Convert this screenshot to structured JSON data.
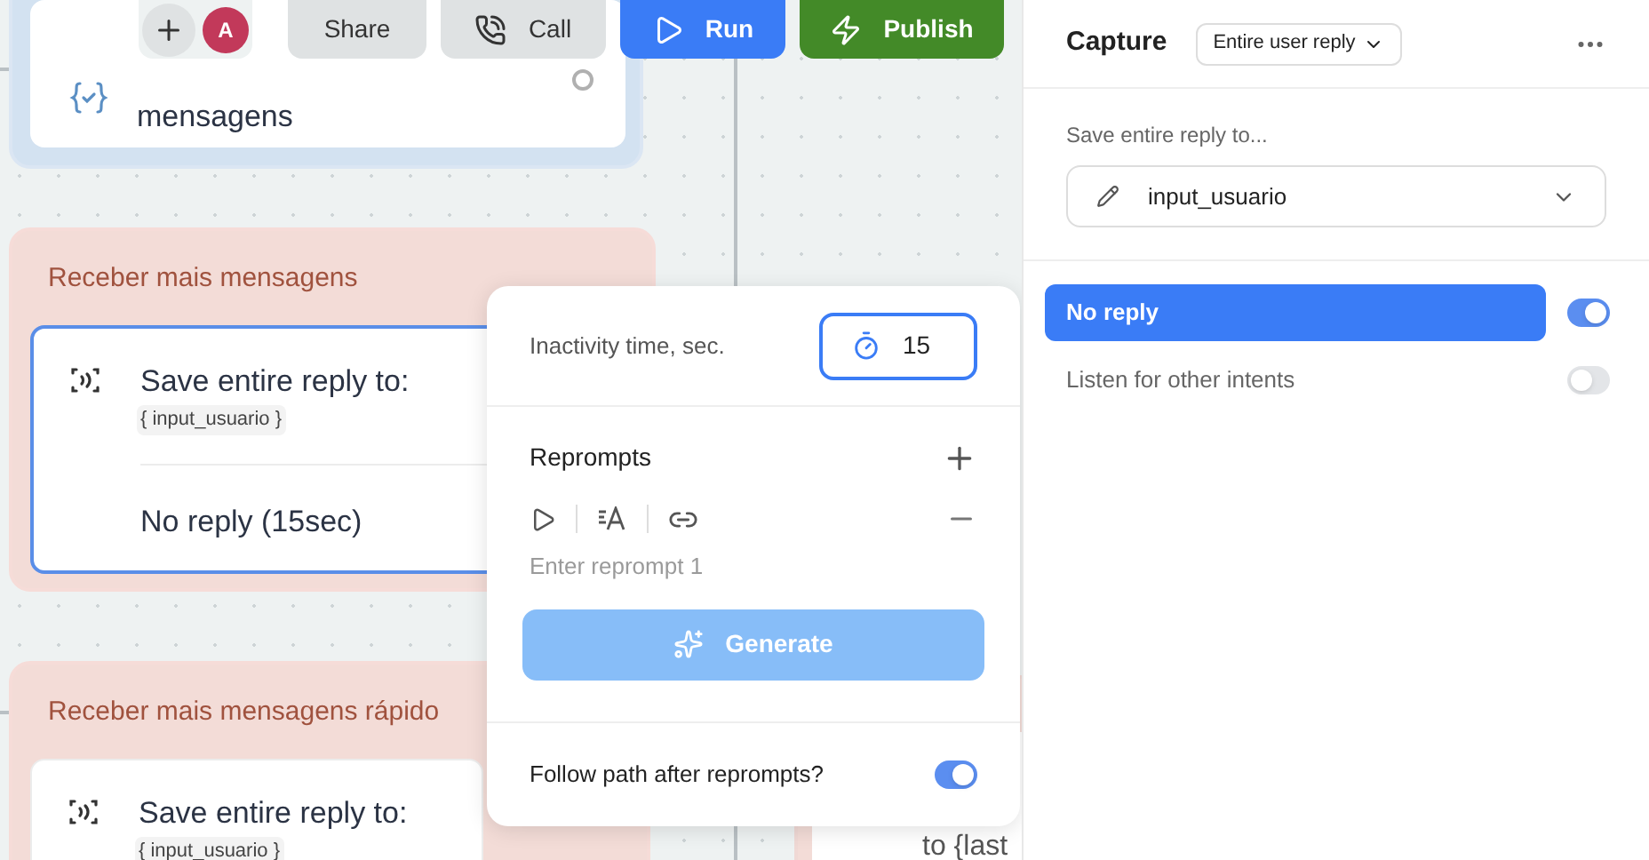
{
  "toolbar": {
    "avatar": "A",
    "buttons": [
      {
        "label": "Share",
        "kind": "plain"
      },
      {
        "label": "Call",
        "kind": "call"
      },
      {
        "label": "Run",
        "kind": "run"
      },
      {
        "label": "Publish",
        "kind": "publish"
      }
    ]
  },
  "canvas": {
    "top_node": {
      "text": "mensagens"
    },
    "groups": [
      {
        "title": "Receber mais mensagens",
        "selected": true,
        "capture_label": "Save entire reply to:",
        "variable": "{ input_usuario }",
        "no_reply": "No reply (15sec)"
      },
      {
        "title": "Receber mais mensagens rápido",
        "selected": false,
        "capture_label": "Save entire reply to:",
        "variable": "{ input_usuario }"
      }
    ],
    "partial_node": {
      "text": "to {last"
    }
  },
  "popover": {
    "inactivity": {
      "label": "Inactivity time, sec.",
      "value": "15"
    },
    "reprompts": {
      "title": "Reprompts",
      "placeholder": "Enter reprompt 1"
    },
    "generate": {
      "label": "Generate",
      "disabled": true
    },
    "follow_path": {
      "label": "Follow path after reprompts?",
      "on": true
    }
  },
  "panel": {
    "title": "Capture",
    "mode": "Entire user reply",
    "save_label": "Save entire reply to...",
    "variable": "input_usuario",
    "options": [
      {
        "label": "No reply",
        "selected": true,
        "on": true
      },
      {
        "label": "Listen for other intents",
        "selected": false,
        "on": false
      }
    ]
  }
}
